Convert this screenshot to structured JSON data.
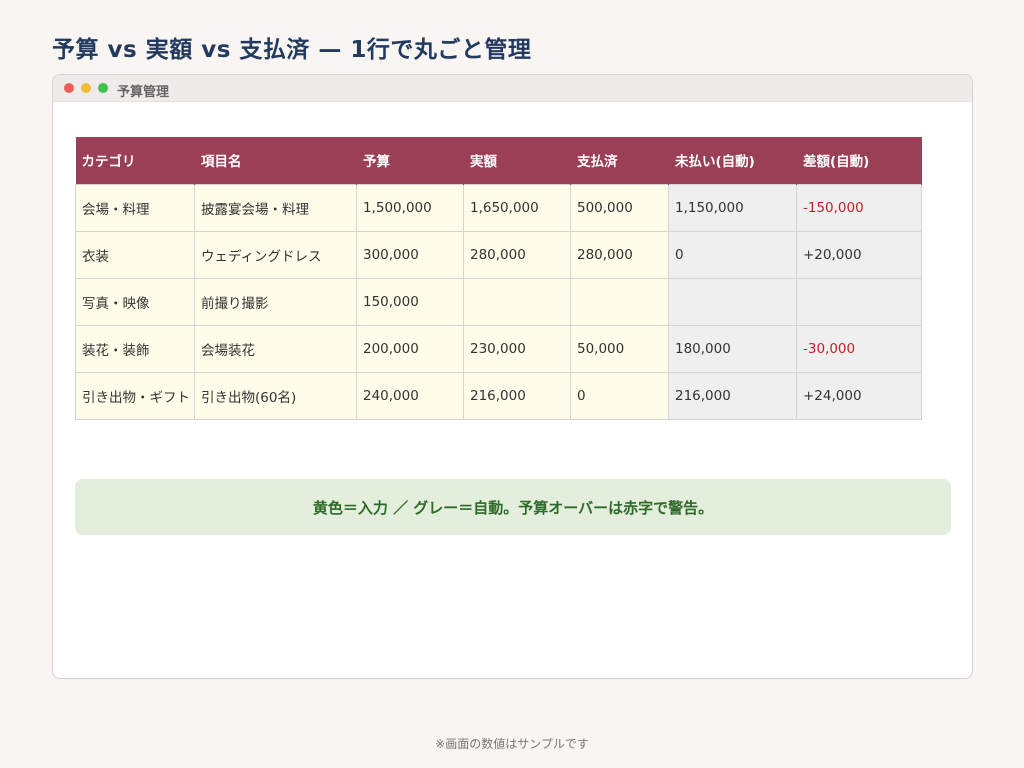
{
  "page_title": "予算 vs 実額 vs 支払済 — 1行で丸ごと管理",
  "window": {
    "title": "予算管理",
    "table": {
      "headers": [
        "カテゴリ",
        "項目名",
        "予算",
        "実額",
        "支払済",
        "未払い(自動)",
        "差額(自動)"
      ],
      "rows": [
        [
          "会場・料理",
          "披露宴会場・料理",
          "1,500,000",
          "1,650,000",
          "500,000",
          "1,150,000",
          "-150,000"
        ],
        [
          "衣装",
          "ウェディングドレス",
          "300,000",
          "280,000",
          "280,000",
          "0",
          "+20,000"
        ],
        [
          "写真・映像",
          "前撮り撮影",
          "150,000",
          "",
          "",
          "",
          ""
        ],
        [
          "装花・装飾",
          "会場装花",
          "200,000",
          "230,000",
          "50,000",
          "180,000",
          "-30,000"
        ],
        [
          "引き出物・ギフト",
          "引き出物(60名)",
          "240,000",
          "216,000",
          "0",
          "216,000",
          "+24,000"
        ]
      ]
    },
    "note": "黄色＝入力 ／ グレー＝自動。予算オーバーは赤字で警告。"
  },
  "footer": "※画面の数値はサンプルです",
  "colors": {
    "header_bg": "#9b3f56",
    "input_cell": "#fffce9",
    "auto_cell": "#efefef",
    "over_budget": "#c0232b",
    "note_bg": "#e3efdc",
    "note_text": "#2f6a2a",
    "title": "#223a5e"
  }
}
